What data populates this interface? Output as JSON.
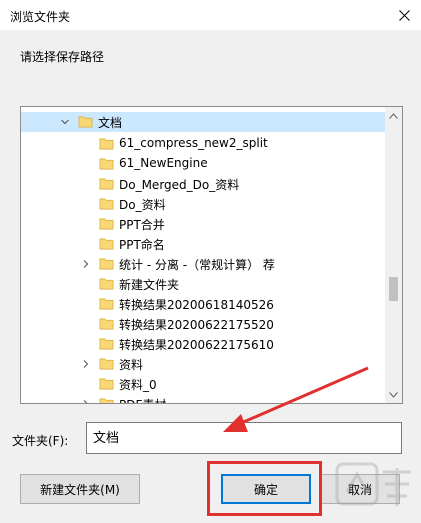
{
  "dialog": {
    "title": "浏览文件夹",
    "prompt": "请选择保存路径"
  },
  "tree": {
    "items": [
      {
        "label": "文档",
        "expander": "expanded",
        "selected": true
      },
      {
        "label": "61_compress_new2_split",
        "expander": "none"
      },
      {
        "label": "61_NewEngine",
        "expander": "none"
      },
      {
        "label": "Do_Merged_Do_资料",
        "expander": "none"
      },
      {
        "label": "Do_资料",
        "expander": "none"
      },
      {
        "label": "PPT合并",
        "expander": "none"
      },
      {
        "label": "PPT命名",
        "expander": "none"
      },
      {
        "label": "统计 - 分离 -（常规计算） 荐",
        "expander": "collapsed"
      },
      {
        "label": "新建文件夹",
        "expander": "none"
      },
      {
        "label": "转换结果20200618140526",
        "expander": "none"
      },
      {
        "label": "转换结果20200622175520",
        "expander": "none"
      },
      {
        "label": "转换结果20200622175610",
        "expander": "none"
      },
      {
        "label": "资料",
        "expander": "collapsed"
      },
      {
        "label": "资料_0",
        "expander": "none"
      },
      {
        "label": "PDF素材",
        "expander": "collapsed"
      }
    ]
  },
  "folder_field": {
    "label": "文件夹(F):",
    "value": "文档"
  },
  "buttons": {
    "new_folder": "新建文件夹(M)",
    "ok": "确定",
    "cancel": "取消"
  },
  "colors": {
    "highlight": "#e03030",
    "selection": "#cce8ff",
    "folder": "#f8d775"
  }
}
